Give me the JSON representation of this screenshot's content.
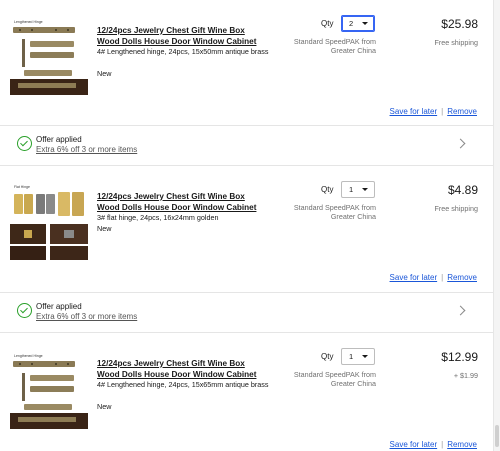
{
  "cart": {
    "items": [
      {
        "title": "12/24pcs Jewelry Chest Gift Wine Box Wood Dolls House Door Window Cabinet",
        "variant": "4# Lengthened hinge, 24pcs, 15x50mm antique brass",
        "condition": "New",
        "qty_label": "Qty",
        "qty_value": "2",
        "shipping_method": "Standard SpeedPAK from Greater China",
        "price": "$25.98",
        "shipping_cost": "Free shipping",
        "save_label": "Save for later",
        "remove_label": "Remove",
        "thumb_icon": "hinge-brass-icon"
      },
      {
        "title": "12/24pcs Jewelry Chest Gift Wine Box Wood Dolls House Door Window Cabinet",
        "variant": "3# flat hinge, 24pcs, 16x24mm golden",
        "condition": "New",
        "qty_label": "Qty",
        "qty_value": "1",
        "shipping_method": "Standard SpeedPAK from Greater China",
        "price": "$4.89",
        "shipping_cost": "Free shipping",
        "save_label": "Save for later",
        "remove_label": "Remove",
        "thumb_icon": "hinge-golden-icon"
      },
      {
        "title": "12/24pcs Jewelry Chest Gift Wine Box Wood Dolls House Door Window Cabinet",
        "variant": "4# Lengthened hinge, 24pcs, 15x65mm antique brass",
        "condition": "New",
        "qty_label": "Qty",
        "qty_value": "1",
        "shipping_method": "Standard SpeedPAK from Greater China",
        "price": "$12.99",
        "shipping_cost": "+ $1.99",
        "save_label": "Save for later",
        "remove_label": "Remove",
        "thumb_icon": "hinge-brass-icon"
      }
    ],
    "offers": [
      {
        "title": "Offer applied",
        "detail": "Extra 6% off 3 or more items"
      },
      {
        "title": "Offer applied",
        "detail": "Extra 6% off 3 or more items"
      }
    ]
  },
  "colors": {
    "link": "#1a56d8",
    "accent": "#3665f3",
    "success": "#2aa02a",
    "muted_text": "#707070"
  },
  "icons": [
    "check-circle-icon",
    "chevron-right-icon",
    "caret-down-icon"
  ]
}
